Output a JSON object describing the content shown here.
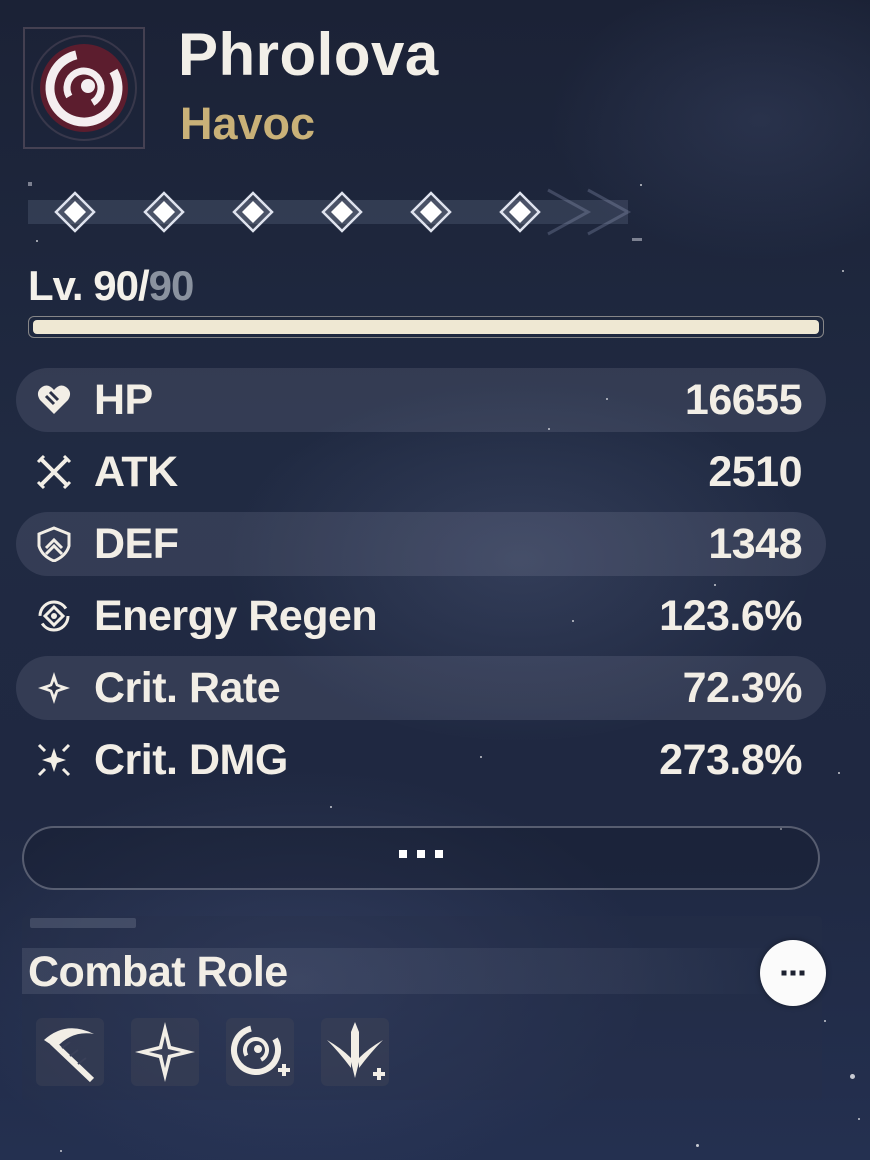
{
  "character": {
    "name": "Phrolova",
    "element": "Havoc"
  },
  "resonance": {
    "nodes": 6
  },
  "level": {
    "current": "Lv. 90/",
    "max": "90",
    "progress": 1.0
  },
  "stats": [
    {
      "icon": "hp-heart-icon",
      "label": "HP",
      "value": "16655"
    },
    {
      "icon": "atk-swords-icon",
      "label": "ATK",
      "value": "2510"
    },
    {
      "icon": "def-shield-icon",
      "label": "DEF",
      "value": "1348"
    },
    {
      "icon": "energy-regen-icon",
      "label": "Energy Regen",
      "value": "123.6%"
    },
    {
      "icon": "crit-rate-star-icon",
      "label": "Crit. Rate",
      "value": "72.3%"
    },
    {
      "icon": "crit-dmg-burst-icon",
      "label": "Crit. DMG",
      "value": "273.8%"
    }
  ],
  "more_button": {
    "icon": "ellipsis-icon"
  },
  "combat_role": {
    "title": "Combat Role",
    "info_icon": "ellipsis-icon",
    "roles": [
      "scythe-attack-icon",
      "star-burst-icon",
      "havoc-swirl-plus-icon",
      "sword-plus-icon"
    ]
  },
  "colors": {
    "element_gold": "#c9b178",
    "text_light": "#f2eee6",
    "level_max_gray": "#8a929f",
    "bar_fill": "#efe8d3"
  }
}
